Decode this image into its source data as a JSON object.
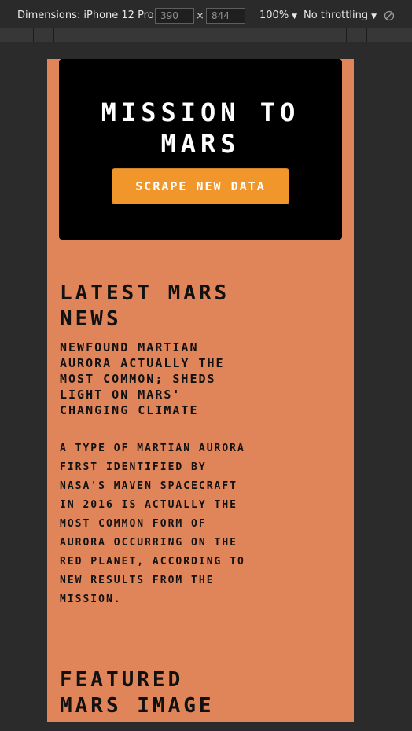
{
  "devtools": {
    "device_label": "Dimensions: iPhone 12 Pro",
    "width_value": "390",
    "height_value": "844",
    "times_symbol": "×",
    "zoom_label": "100%",
    "throttle_label": "No throttling",
    "caret": "▼"
  },
  "page": {
    "title": "Mission to Mars",
    "scrape_button": "Scrape New Data",
    "news_heading": "Latest Mars News",
    "news_title": "Newfound Martian Aurora Actually the Most Common; Sheds Light on Mars' Changing Climate",
    "news_body": "A type of Martian aurora first identified by NASA's MAVEN spacecraft in 2016 is actually the most common form of aurora occurring on the Red Planet, according to new results from the mission.",
    "image_heading": "Featured Mars Image"
  },
  "colors": {
    "page_background": "#e0845a",
    "jumbotron": "#000000",
    "button": "#f0962a"
  }
}
